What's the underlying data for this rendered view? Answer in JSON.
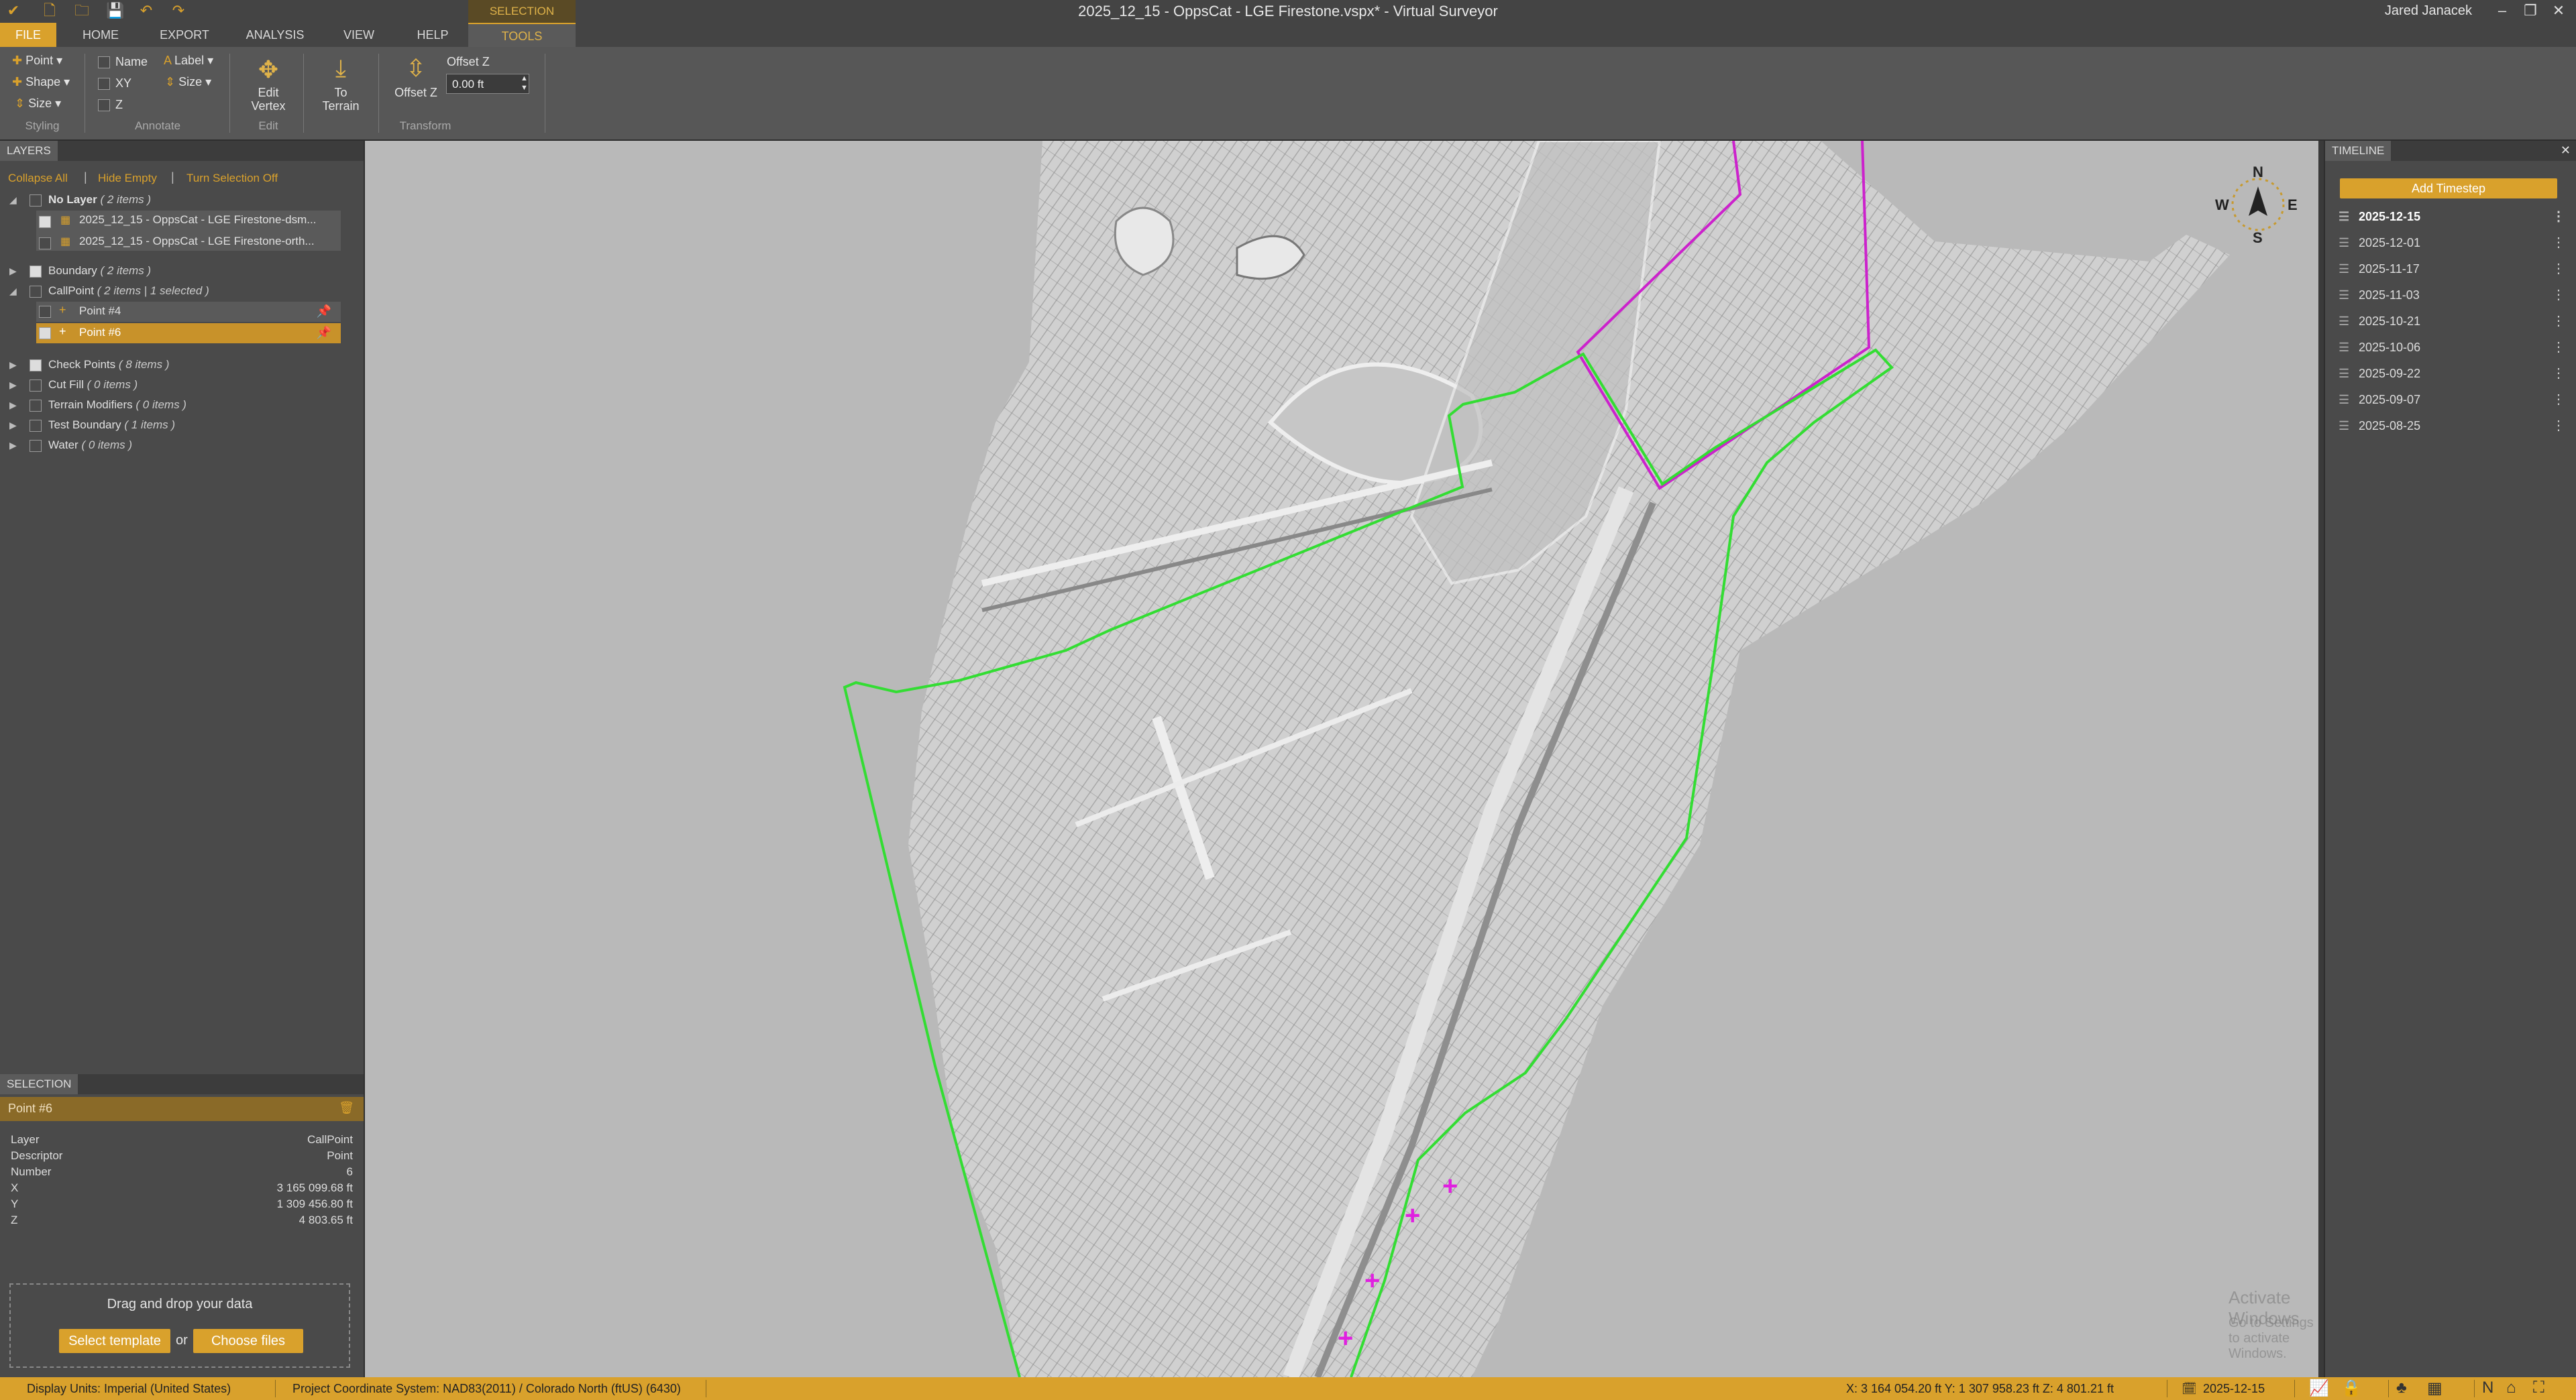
{
  "window": {
    "title": "2025_12_15 - OppsCat - LGE Firestone.vspx* - Virtual Surveyor",
    "user": "Jared Janacek",
    "minimize": "–",
    "restore": "❐",
    "close": "✕"
  },
  "ribbon": {
    "context_tab": "SELECTION",
    "tabs": [
      "FILE",
      "HOME",
      "EXPORT",
      "ANALYSIS",
      "VIEW",
      "HELP",
      "TOOLS"
    ],
    "styling": {
      "point": "Point",
      "shape": "Shape",
      "size": "Size",
      "label": "Styling"
    },
    "annotate": {
      "name": "Name",
      "xy": "XY",
      "z": "Z",
      "label_btn": "Label",
      "size": "Size",
      "label": "Annotate"
    },
    "edit": {
      "btn": "Edit Vertex",
      "label": "Edit"
    },
    "to_terrain": {
      "btn": "To Terrain"
    },
    "transform": {
      "offset_btn": "Offset Z",
      "offset_label": "Offset Z",
      "offset_value": "0.00 ft",
      "label": "Transform"
    }
  },
  "layers": {
    "header": "LAYERS",
    "links": [
      "Collapse All",
      "Hide Empty",
      "Turn Selection Off"
    ],
    "tree": [
      {
        "name": "No Layer",
        "count": "( 2 items )",
        "bold": true
      },
      {
        "name": "2025_12_15 - OppsCat - LGE Firestone-dsm...",
        "child": true
      },
      {
        "name": "2025_12_15 - OppsCat - LGE Firestone-orth...",
        "child": true
      },
      {
        "name": "Boundary",
        "count": "( 2 items )"
      },
      {
        "name": "CallPoint",
        "count": "( 2 items |",
        "extra": "1 selected",
        "close": ")"
      },
      {
        "name": "Point #4",
        "child": true
      },
      {
        "name": "Point #6",
        "child": true,
        "selected": true
      },
      {
        "name": "Check Points",
        "count": "( 8 items )"
      },
      {
        "name": "Cut Fill",
        "count": "( 0 items )"
      },
      {
        "name": "Terrain Modifiers",
        "count": "( 0 items )"
      },
      {
        "name": "Test Boundary",
        "count": "( 1 items )"
      },
      {
        "name": "Water",
        "count": "( 0 items )"
      }
    ]
  },
  "selection": {
    "header": "SELECTION",
    "title": "Point #6",
    "props": [
      {
        "k": "Layer",
        "v": "CallPoint"
      },
      {
        "k": "Descriptor",
        "v": "Point"
      },
      {
        "k": "Number",
        "v": "6"
      },
      {
        "k": "X",
        "v": "3 165 099.68 ft"
      },
      {
        "k": "Y",
        "v": "1 309 456.80 ft"
      },
      {
        "k": "Z",
        "v": "4 803.65 ft"
      }
    ]
  },
  "dropzone": {
    "text": "Drag and drop your data",
    "template_btn": "Select template",
    "or": "or",
    "files_btn": "Choose files"
  },
  "compass": {
    "n": "N",
    "s": "S",
    "e": "E",
    "w": "W"
  },
  "timeline": {
    "header": "TIMELINE",
    "close": "✕",
    "add_btn": "Add Timestep",
    "dates": [
      "2025-12-15",
      "2025-12-01",
      "2025-11-17",
      "2025-11-03",
      "2025-10-21",
      "2025-10-06",
      "2025-09-22",
      "2025-09-07",
      "2025-08-25"
    ]
  },
  "watermark": {
    "line1": "Activate Windows",
    "line2": "Go to Settings to activate Windows."
  },
  "status": {
    "units": "Display Units:  Imperial (United States)",
    "crs": "Project Coordinate System:  NAD83(2011) / Colorado North (ftUS) (6430)",
    "coords": "X: 3 164 054.20 ft    Y: 1 307 958.23 ft    Z: 4 801.21 ft",
    "date": "2025-12-15"
  },
  "colors": {
    "accent": "#d9a12c",
    "boundary_green": "#33dd33",
    "boundary_magenta": "#cc22cc",
    "point_magenta": "#e020e0"
  }
}
